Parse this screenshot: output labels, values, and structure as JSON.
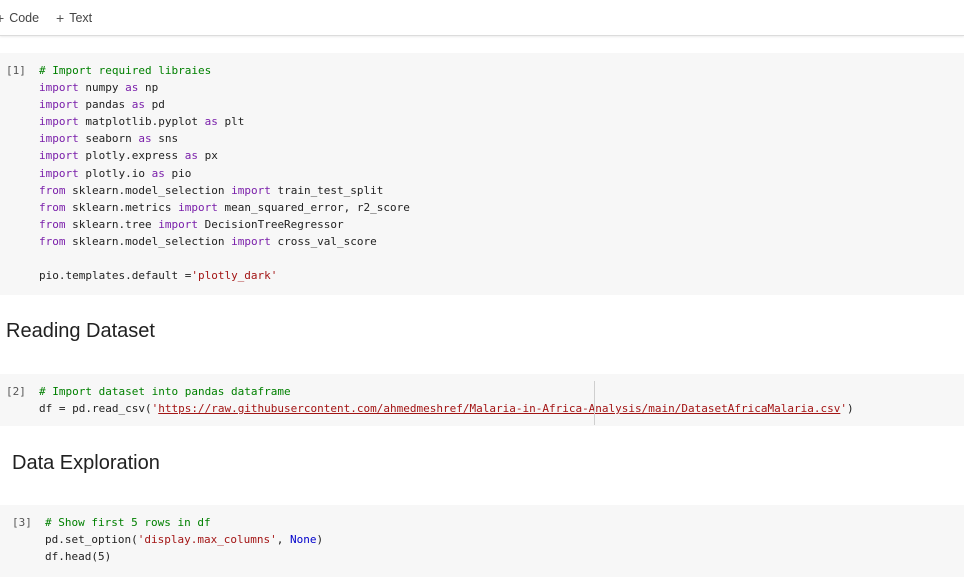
{
  "toolbar": {
    "code_label": "Code",
    "text_label": "Text",
    "plus_symbol": "+"
  },
  "cells": [
    {
      "prompt": "[1]",
      "lines": [
        [
          {
            "t": "cm",
            "v": "# Import required libraies"
          }
        ],
        [
          {
            "t": "kw",
            "v": "import"
          },
          {
            "t": "pl",
            "v": " numpy "
          },
          {
            "t": "kw",
            "v": "as"
          },
          {
            "t": "pl",
            "v": " np"
          }
        ],
        [
          {
            "t": "kw",
            "v": "import"
          },
          {
            "t": "pl",
            "v": " pandas "
          },
          {
            "t": "kw",
            "v": "as"
          },
          {
            "t": "pl",
            "v": " pd"
          }
        ],
        [
          {
            "t": "kw",
            "v": "import"
          },
          {
            "t": "pl",
            "v": " matplotlib.pyplot "
          },
          {
            "t": "kw",
            "v": "as"
          },
          {
            "t": "pl",
            "v": " plt"
          }
        ],
        [
          {
            "t": "kw",
            "v": "import"
          },
          {
            "t": "pl",
            "v": " seaborn "
          },
          {
            "t": "kw",
            "v": "as"
          },
          {
            "t": "pl",
            "v": " sns"
          }
        ],
        [
          {
            "t": "kw",
            "v": "import"
          },
          {
            "t": "pl",
            "v": " plotly.express "
          },
          {
            "t": "kw",
            "v": "as"
          },
          {
            "t": "pl",
            "v": " px"
          }
        ],
        [
          {
            "t": "kw",
            "v": "import"
          },
          {
            "t": "pl",
            "v": " plotly.io "
          },
          {
            "t": "kw",
            "v": "as"
          },
          {
            "t": "pl",
            "v": " pio"
          }
        ],
        [
          {
            "t": "kw",
            "v": "from"
          },
          {
            "t": "pl",
            "v": " sklearn.model_selection "
          },
          {
            "t": "kw",
            "v": "import"
          },
          {
            "t": "pl",
            "v": " train_test_split"
          }
        ],
        [
          {
            "t": "kw",
            "v": "from"
          },
          {
            "t": "pl",
            "v": " sklearn.metrics "
          },
          {
            "t": "kw",
            "v": "import"
          },
          {
            "t": "pl",
            "v": " mean_squared_error, r2_score"
          }
        ],
        [
          {
            "t": "kw",
            "v": "from"
          },
          {
            "t": "pl",
            "v": " sklearn.tree "
          },
          {
            "t": "kw",
            "v": "import"
          },
          {
            "t": "pl",
            "v": " DecisionTreeRegressor"
          }
        ],
        [
          {
            "t": "kw",
            "v": "from"
          },
          {
            "t": "pl",
            "v": " sklearn.model_selection "
          },
          {
            "t": "kw",
            "v": "import"
          },
          {
            "t": "pl",
            "v": " cross_val_score"
          }
        ],
        [],
        [
          {
            "t": "pl",
            "v": "pio.templates.default ="
          },
          {
            "t": "str",
            "v": "'plotly_dark'"
          }
        ]
      ]
    },
    {
      "prompt": "[2]",
      "lines": [
        [
          {
            "t": "cm",
            "v": "# Import dataset into pandas dataframe"
          }
        ],
        [
          {
            "t": "pl",
            "v": "df = pd.read_csv("
          },
          {
            "t": "str",
            "v": "'"
          },
          {
            "t": "url",
            "v": "https://raw.githubusercontent.com/ahmedmeshref/Malaria-in-Africa-Analysis/main/DatasetAfricaMalaria.csv"
          },
          {
            "t": "str",
            "v": "'"
          },
          {
            "t": "pl",
            "v": ")"
          }
        ]
      ]
    },
    {
      "prompt": "[3]",
      "lines": [
        [
          {
            "t": "cm",
            "v": "# Show first 5 rows in df"
          }
        ],
        [
          {
            "t": "pl",
            "v": "pd.set_option("
          },
          {
            "t": "str",
            "v": "'display.max_columns'"
          },
          {
            "t": "pl",
            "v": ", "
          },
          {
            "t": "kwb",
            "v": "None"
          },
          {
            "t": "pl",
            "v": ")"
          }
        ],
        [
          {
            "t": "pl",
            "v": "df.head(5)"
          }
        ]
      ]
    }
  ],
  "headings": {
    "reading": "Reading Dataset",
    "exploration": "Data Exploration"
  }
}
